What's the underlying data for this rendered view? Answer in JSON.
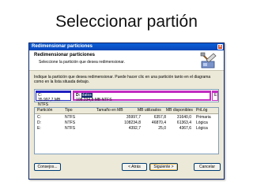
{
  "slide": {
    "title": "Seleccionar partión"
  },
  "window": {
    "title": "Redimensionar particiones",
    "close_glyph": "x",
    "header_title": "Redimensionar particiones",
    "header_subtitle": "Seleccione la partición que desea redimensionar.",
    "header_icon": "resize-tool-icon",
    "instruction": "Indique la partición que desea redimensionar. Puede hacer clic en una partición tanto en el diagrama como en la lista situada debajo."
  },
  "partition_bar": [
    {
      "drive": "C:",
      "info": "35.997,7 MB  NTFS",
      "color": "#2020c0"
    },
    {
      "drive": "D:",
      "label": "datos",
      "info": "108.234,8 MB  NTFS",
      "color": "#c02cc0",
      "selected": true
    },
    {
      "drive": "E:",
      "info": "",
      "color": "#c02cc0"
    }
  ],
  "table": {
    "columns": [
      "Partición",
      "Tipo",
      "Tamaño en MB",
      "MB utilizados",
      "MB disponibles",
      "PriLóg"
    ],
    "rows": [
      [
        "C:",
        "NTFS",
        "35997,7",
        "6357,8",
        "31640,0",
        "Primaria"
      ],
      [
        "D:",
        "NTFS",
        "108234,8",
        "46870,4",
        "61363,4",
        "Lógica"
      ],
      [
        "E:",
        "NTFS",
        "4392,7",
        "25,0",
        "4367,6",
        "Lógica"
      ]
    ]
  },
  "buttons": {
    "help": "Consejos...",
    "back": "< Atrás",
    "next": "Siguiente >",
    "cancel": "Cancelar"
  }
}
